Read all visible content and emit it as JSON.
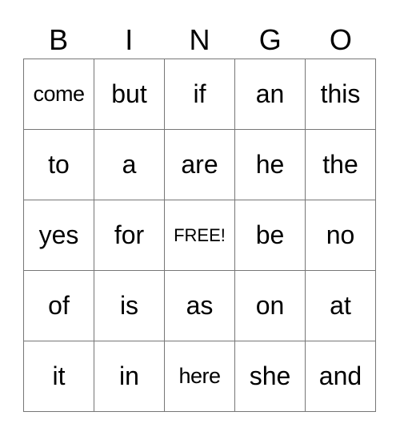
{
  "header": [
    "B",
    "I",
    "N",
    "G",
    "O"
  ],
  "cells": [
    [
      "come",
      "but",
      "if",
      "an",
      "this"
    ],
    [
      "to",
      "a",
      "are",
      "he",
      "the"
    ],
    [
      "yes",
      "for",
      "FREE!",
      "be",
      "no"
    ],
    [
      "of",
      "is",
      "as",
      "on",
      "at"
    ],
    [
      "it",
      "in",
      "here",
      "she",
      "and"
    ]
  ]
}
